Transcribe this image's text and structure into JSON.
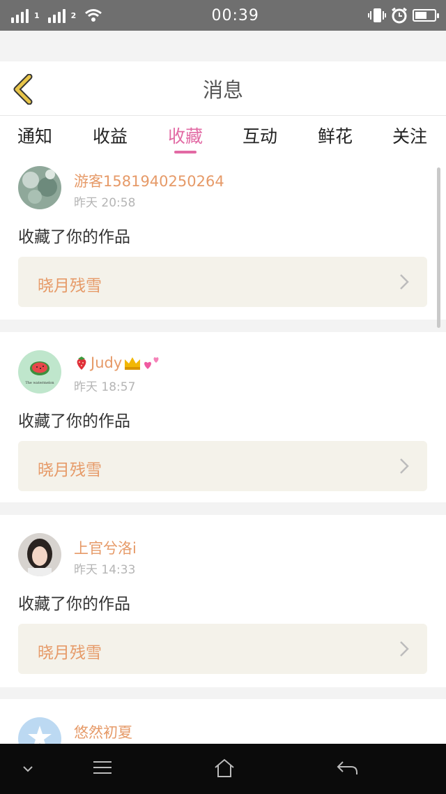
{
  "status_bar": {
    "time": "00:39",
    "sim1": "1",
    "sim2": "2",
    "icons": [
      "signal-icon",
      "wifi-icon",
      "vibrate-icon",
      "alarm-icon",
      "battery-icon"
    ]
  },
  "header": {
    "title": "消息",
    "back_icon": "chevron-left-icon"
  },
  "tabs": [
    {
      "label": "通知",
      "active": false
    },
    {
      "label": "收益",
      "active": false
    },
    {
      "label": "收藏",
      "active": true
    },
    {
      "label": "互动",
      "active": false
    },
    {
      "label": "鲜花",
      "active": false
    },
    {
      "label": "关注",
      "active": false
    }
  ],
  "feed": [
    {
      "username": "游客1581940250264",
      "time": "昨天 20:58",
      "action": "收藏了你的作品",
      "work": "晓月残雪",
      "avatar": "avatar-landscape"
    },
    {
      "username": "Judy",
      "username_prefix_icon": "strawberry-icon",
      "username_suffix_icons": [
        "crown-icon",
        "hearts-icon"
      ],
      "time": "昨天 18:57",
      "action": "收藏了你的作品",
      "work": "晓月残雪",
      "avatar": "avatar-watermelon",
      "avatar_caption": "The watermelon"
    },
    {
      "username": "上官兮洛i",
      "time": "昨天 14:33",
      "action": "收藏了你的作品",
      "work": "晓月残雪",
      "avatar": "avatar-portrait"
    },
    {
      "username": "悠然初夏",
      "avatar": "avatar-default"
    }
  ],
  "colors": {
    "accent": "#e26aa4",
    "username": "#e69a68",
    "back_icon": "#e8c54a",
    "work_box_bg": "#f4f2ea",
    "status_bar_bg": "#6f6f6f",
    "navbar_bg": "#0b0b0b"
  },
  "navbar": {
    "icons": [
      "chevron-down-icon",
      "menu-icon",
      "home-icon",
      "back-arrow-icon"
    ]
  }
}
